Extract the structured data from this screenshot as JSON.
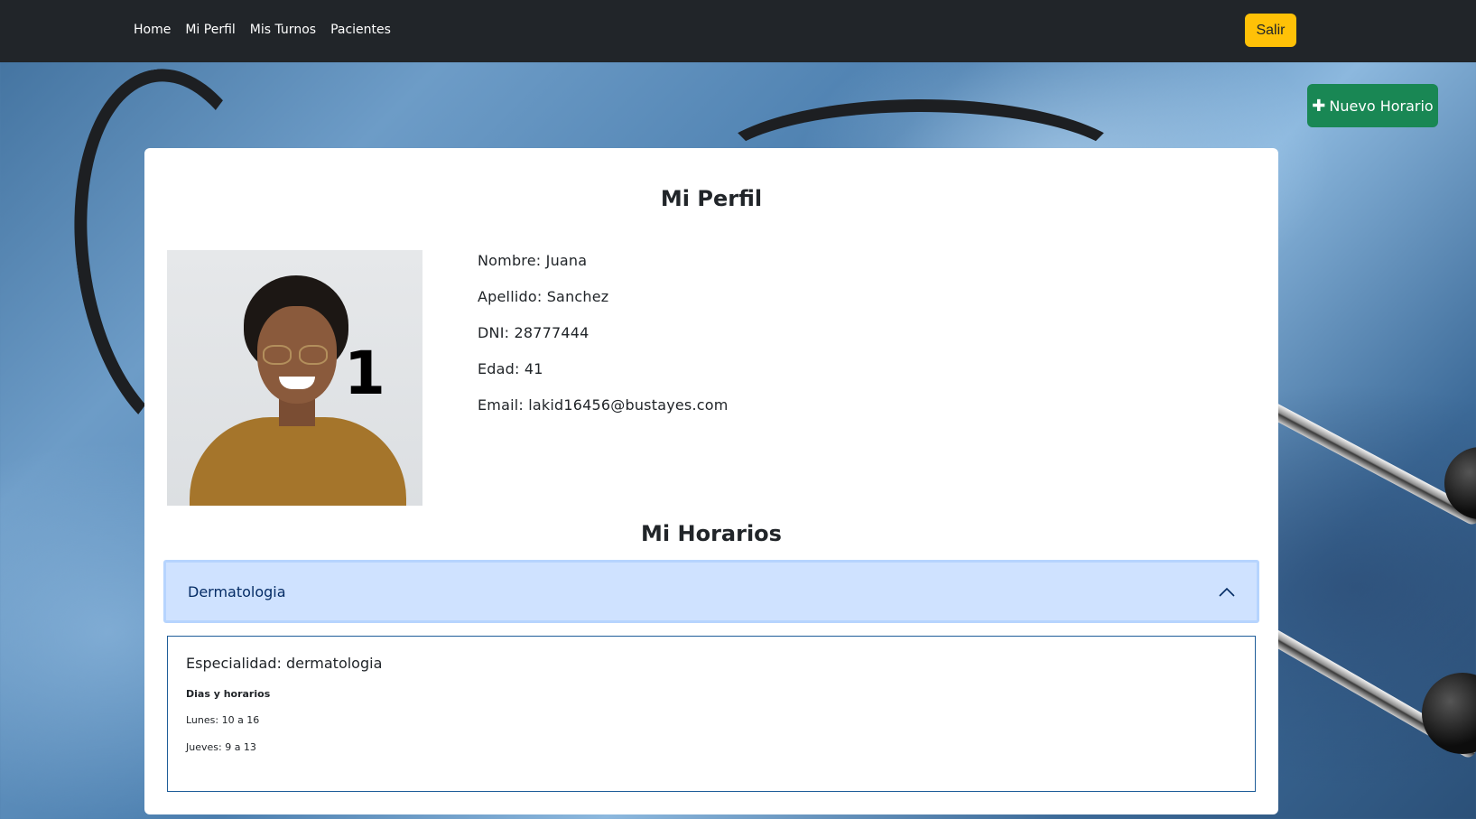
{
  "nav": {
    "links": [
      "Home",
      "Mi Perfil",
      "Mis Turnos",
      "Pacientes"
    ],
    "logout_label": "Salir"
  },
  "actions": {
    "new_schedule_label": "Nuevo Horario",
    "new_schedule_icon": "plus-icon"
  },
  "profile": {
    "title": "Mi Perfil",
    "photo_number": "1",
    "fields": {
      "nombre": "Nombre: Juana",
      "apellido": "Apellido: Sanchez",
      "dni": "DNI: 28777444",
      "edad": "Edad: 41",
      "email": "Email: lakid16456@bustayes.com"
    }
  },
  "schedules": {
    "title": "Mi Horarios",
    "items": [
      {
        "header": "Dermatologia",
        "expanded": true,
        "especialidad": "Especialidad: dermatologia",
        "dias_title": "Dias y horarios",
        "dias": [
          "Lunes: 10 a 16",
          "Jueves: 9 a 13"
        ]
      }
    ]
  },
  "colors": {
    "navbar": "#212529",
    "logout_button": "#ffc107",
    "new_button": "#198754",
    "accordion_header": "#cfe2ff",
    "accordion_border": "#1f5d99"
  }
}
